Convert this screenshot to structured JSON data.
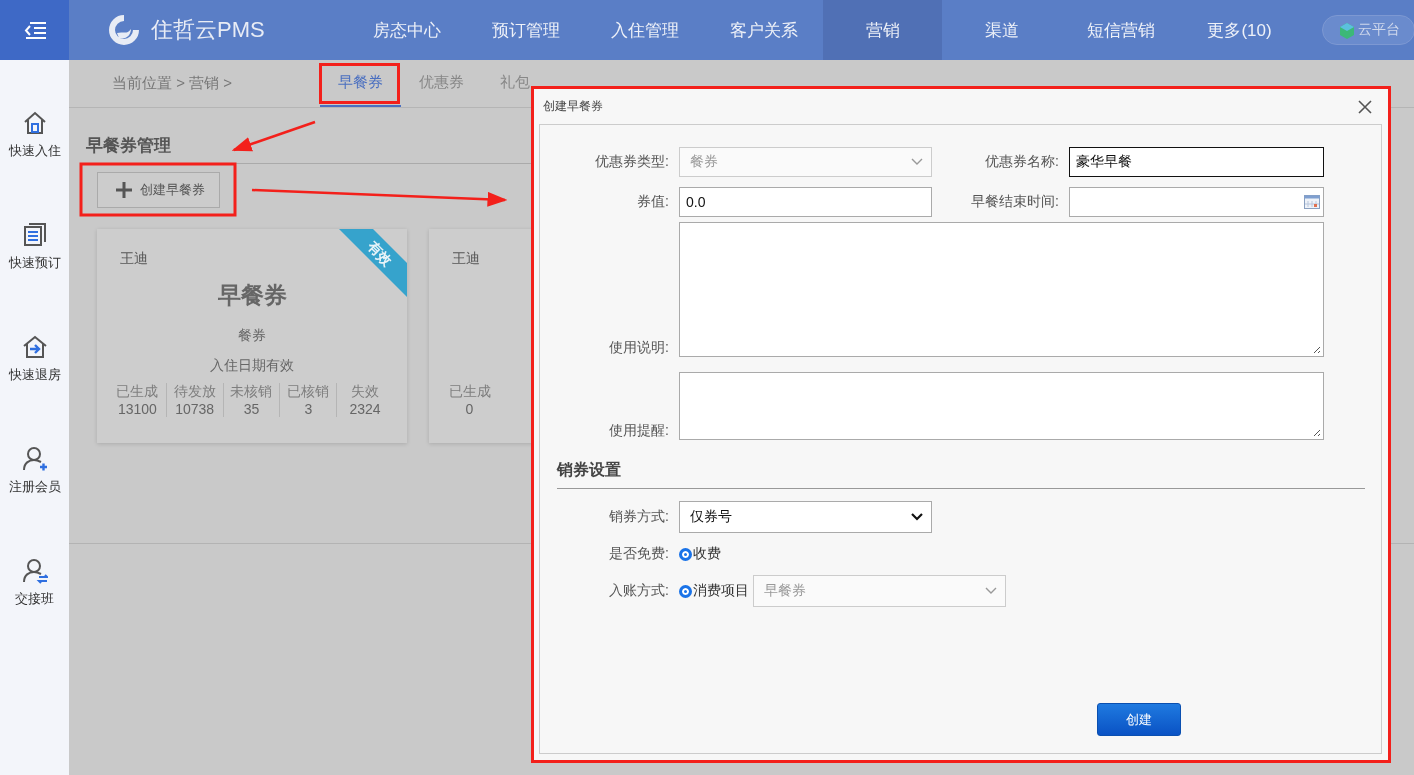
{
  "header": {
    "logo_text": "住哲云PMS",
    "nav": [
      {
        "label": "房态中心",
        "selected": false
      },
      {
        "label": "预订管理",
        "selected": false
      },
      {
        "label": "入住管理",
        "selected": false
      },
      {
        "label": "客户关系",
        "selected": false
      },
      {
        "label": "营销",
        "selected": true
      },
      {
        "label": "渠道",
        "selected": false
      },
      {
        "label": "短信营销",
        "selected": false
      },
      {
        "label": "更多(10)",
        "selected": false
      }
    ],
    "cloud_button": "云平台"
  },
  "sidebar": {
    "items": [
      {
        "label": "快速入住",
        "kind": "checkin"
      },
      {
        "label": "快速预订",
        "kind": "booking"
      },
      {
        "label": "快速退房",
        "kind": "checkout"
      },
      {
        "label": "注册会员",
        "kind": "member"
      },
      {
        "label": "交接班",
        "kind": "shift"
      }
    ]
  },
  "breadcrumb": "当前位置 > 营销 >",
  "tabs": [
    {
      "label": "早餐券",
      "selected": true
    },
    {
      "label": "优惠券",
      "selected": false
    },
    {
      "label": "礼包",
      "selected": false
    }
  ],
  "section_title": "早餐券管理",
  "create_button": "创建早餐券",
  "cards": [
    {
      "owner": "王迪",
      "title": "早餐券",
      "type": "餐券",
      "validity": "入住日期有效",
      "status": "有效",
      "stats": [
        {
          "label": "已生成",
          "value": "13100"
        },
        {
          "label": "待发放",
          "value": "10738"
        },
        {
          "label": "未核销",
          "value": "35"
        },
        {
          "label": "已核销",
          "value": "3"
        },
        {
          "label": "失效",
          "value": "2324"
        }
      ]
    },
    {
      "owner": "王迪",
      "stats": [
        {
          "label": "已生成",
          "value": "0"
        }
      ]
    }
  ],
  "dialog": {
    "title": "创建早餐券",
    "type_label": "优惠券类型:",
    "type_value": "餐券",
    "type_disabled": true,
    "name_label": "优惠券名称:",
    "name_value": "豪华早餐",
    "value_label": "券值:",
    "value_value": "0.0",
    "end_label": "早餐结束时间:",
    "desc_label": "使用说明:",
    "reminder_label": "使用提醒:",
    "section": "销券设置",
    "method_label": "销券方式:",
    "method_value": "仅券号",
    "method_disabled": false,
    "free_label": "是否免费:",
    "free_option": "收费",
    "free_checked": true,
    "account_label": "入账方式:",
    "account_option": "消费项目",
    "account_checked": true,
    "account_item": "早餐券",
    "account_item_disabled": true,
    "submit": "创建"
  }
}
